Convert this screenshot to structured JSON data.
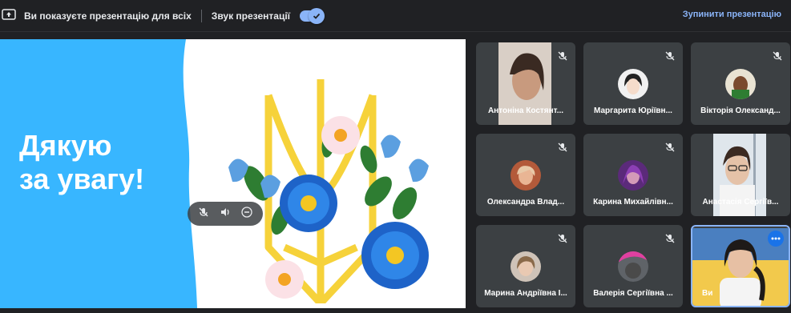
{
  "topbar": {
    "presenting_text": "Ви показуєте презентацію для всіх",
    "sound_label": "Звук презентації",
    "stop_label": "Зупинити презентацію"
  },
  "slide": {
    "title_line1": "Дякую",
    "title_line2": "за увагу!"
  },
  "participants": [
    {
      "name": "Антоніна Костянт..."
    },
    {
      "name": "Маргарита Юріївн..."
    },
    {
      "name": "Вікторія Олександ..."
    },
    {
      "name": "Олександра Влад..."
    },
    {
      "name": "Карина Михайлівн..."
    },
    {
      "name": "Анастасія Сергіїв..."
    },
    {
      "name": "Марина Андріївна І..."
    },
    {
      "name": "Валерія Сергіївна ..."
    },
    {
      "name": "Ви"
    }
  ],
  "colors": {
    "accent": "#8ab4f8",
    "slide_blue": "#38b6ff",
    "tile_bg": "#3c4043"
  }
}
